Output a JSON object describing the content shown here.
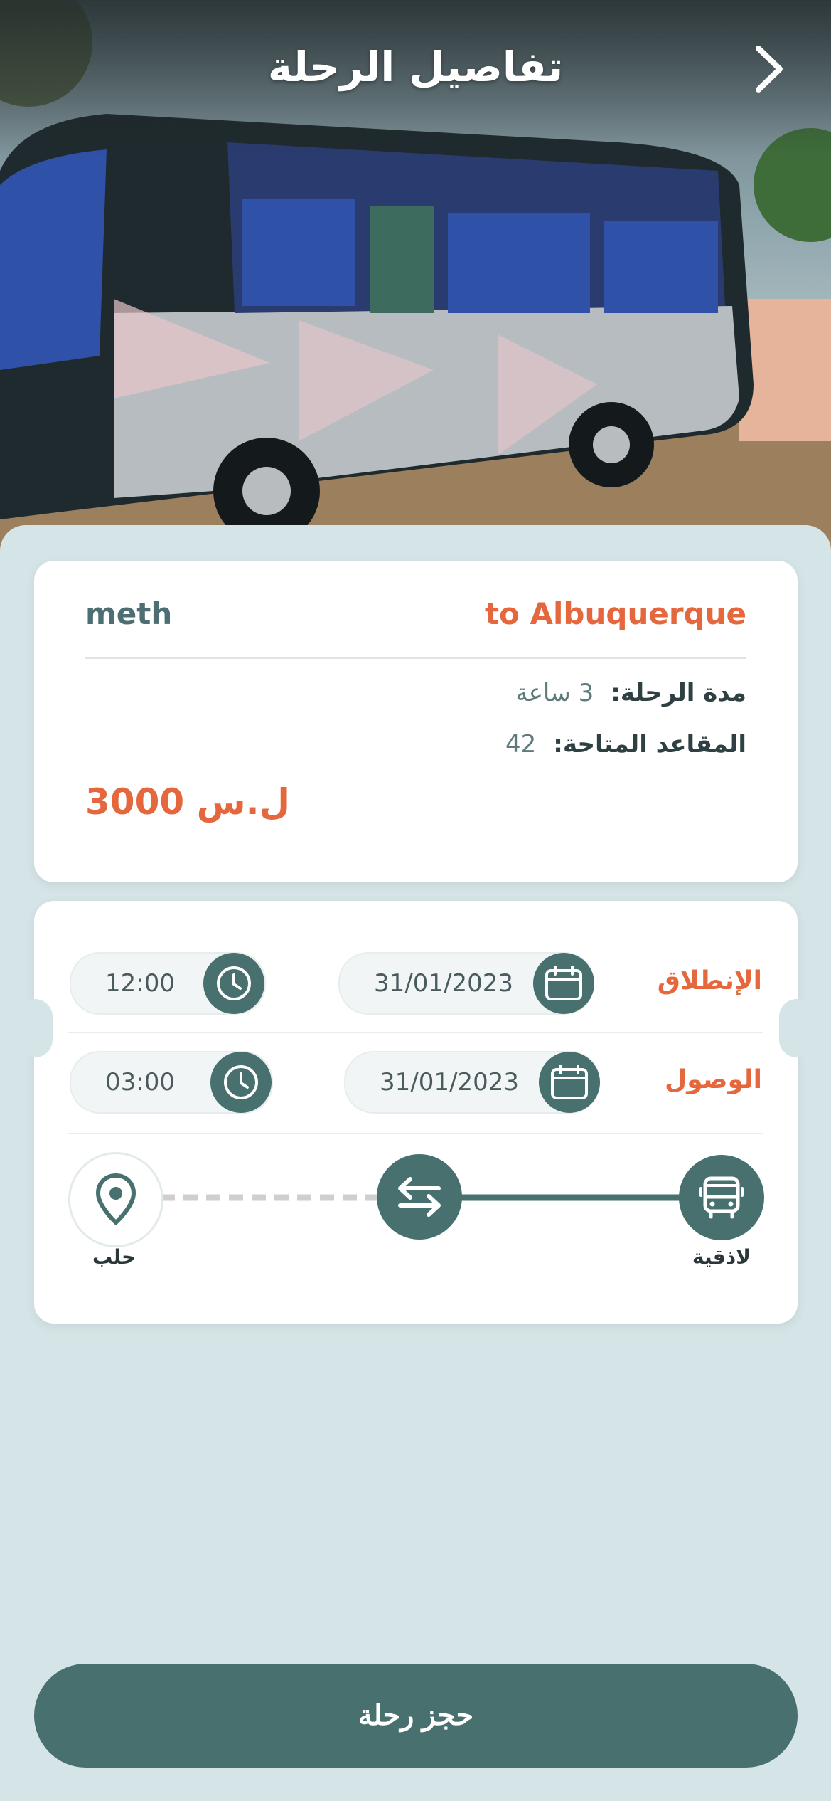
{
  "header": {
    "title": "تفاصيل الرحلة",
    "back_icon": "chevron-right-icon"
  },
  "hero": {
    "image": "bus-photo"
  },
  "trip": {
    "destination": "to Albuquerque",
    "origin": "meth",
    "duration_label": "مدة الرحلة:",
    "duration_value": "3 ساعة",
    "seats_label": "المقاعد المتاحة:",
    "seats_value": "42",
    "price": "3000 ل.س"
  },
  "schedule": {
    "departure": {
      "label": "الإنطلاق",
      "date": "31/01/2023",
      "time": "12:00"
    },
    "arrival": {
      "label": "الوصول",
      "date": "31/01/2023",
      "time": "03:00"
    }
  },
  "route": {
    "start_city": "لاذقية",
    "end_city": "حلب",
    "start_icon": "bus-icon",
    "middle_icon": "swap-arrows-icon",
    "end_icon": "location-pin-icon"
  },
  "actions": {
    "book_label": "حجز رحلة"
  },
  "colors": {
    "accent": "#e4673d",
    "primary": "#47706f",
    "background": "#d5e4e6"
  }
}
